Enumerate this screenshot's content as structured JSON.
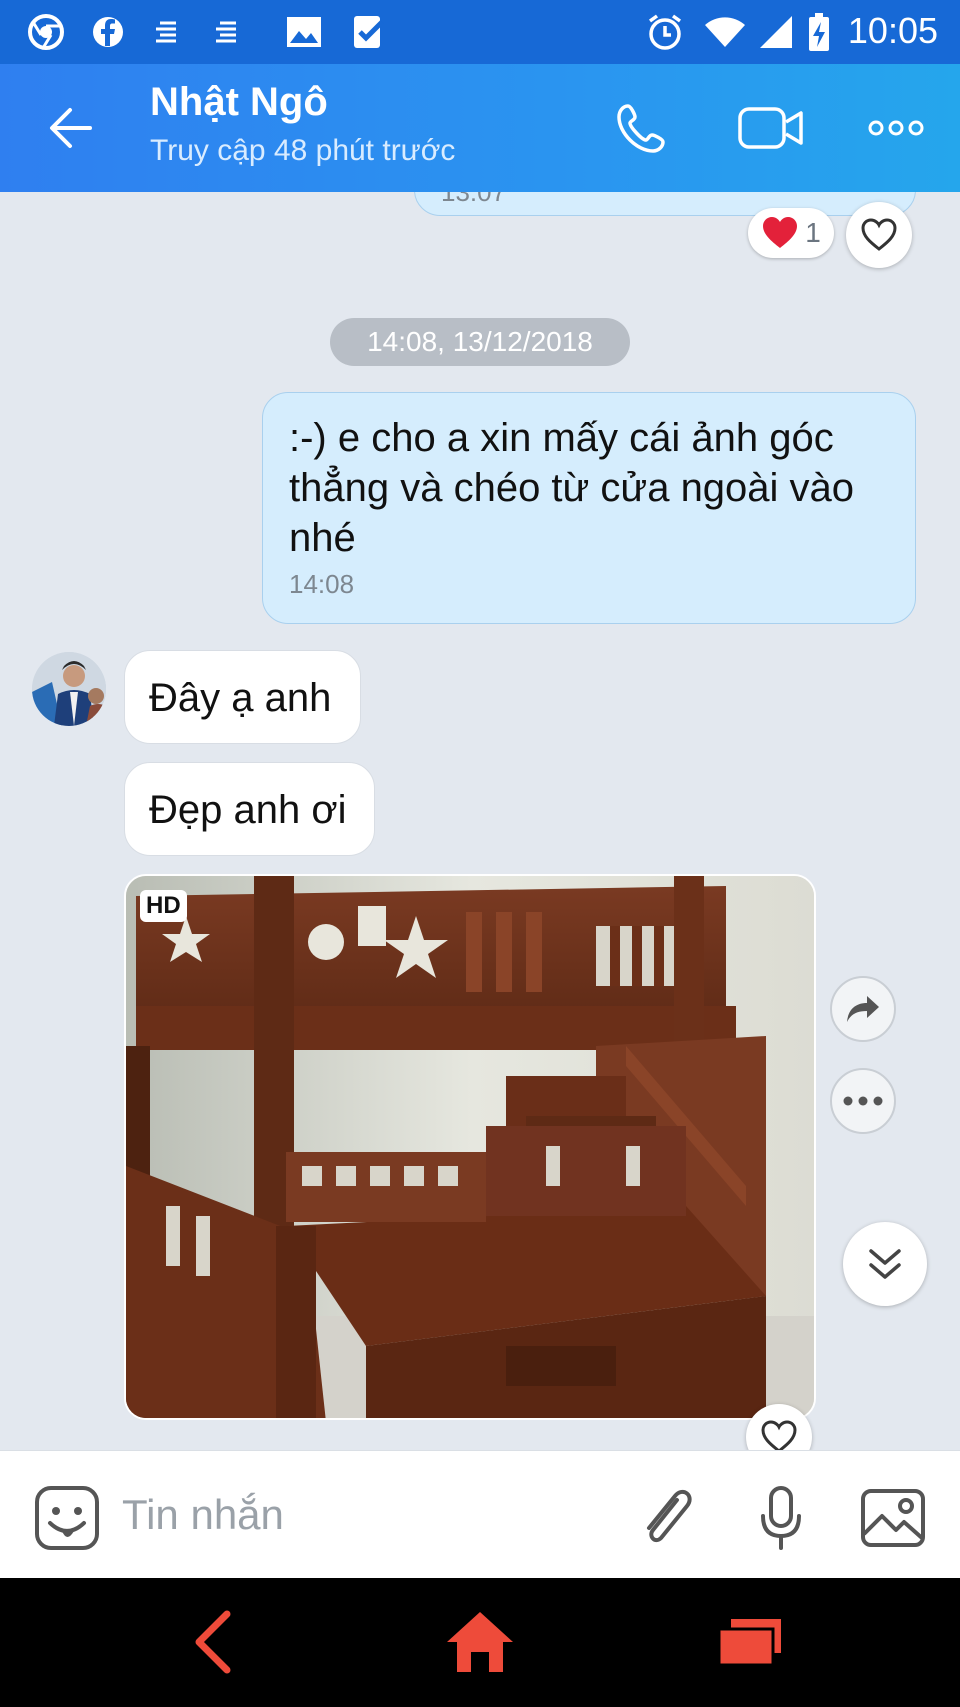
{
  "status_bar": {
    "time": "10:05",
    "icons": [
      "chrome-icon",
      "facebook-icon",
      "notification-lines-icon",
      "notification-lines-icon",
      "gallery-icon",
      "check-task-icon",
      "alarm-icon",
      "wifi-icon",
      "signal-icon",
      "battery-charging-icon"
    ]
  },
  "header": {
    "name": "Nhật Ngô",
    "status": "Truy cập 48 phút trước",
    "actions": [
      "back-arrow-icon",
      "phone-icon",
      "video-call-icon",
      "more-options-icon"
    ]
  },
  "messages": {
    "prev_time": "13:07",
    "prev_reaction_count": "1",
    "date_separator": "14:08, 13/12/2018",
    "outgoing_text": ":-) e cho a xin mấy cái ảnh góc thẳng và chéo từ cửa ngoài vào nhé",
    "outgoing_time": "14:08",
    "incoming_1": "Đây ạ anh",
    "incoming_2": "Đẹp anh ơi",
    "photo_badge": "HD"
  },
  "input": {
    "placeholder": "Tin nhắn"
  },
  "colors": {
    "header_start": "#2f7ff0",
    "header_end": "#25a6ec",
    "outgoing_bubble": "#d5edfd",
    "chat_background": "#e3e8ef",
    "nav_accent": "#ee4b3a"
  }
}
